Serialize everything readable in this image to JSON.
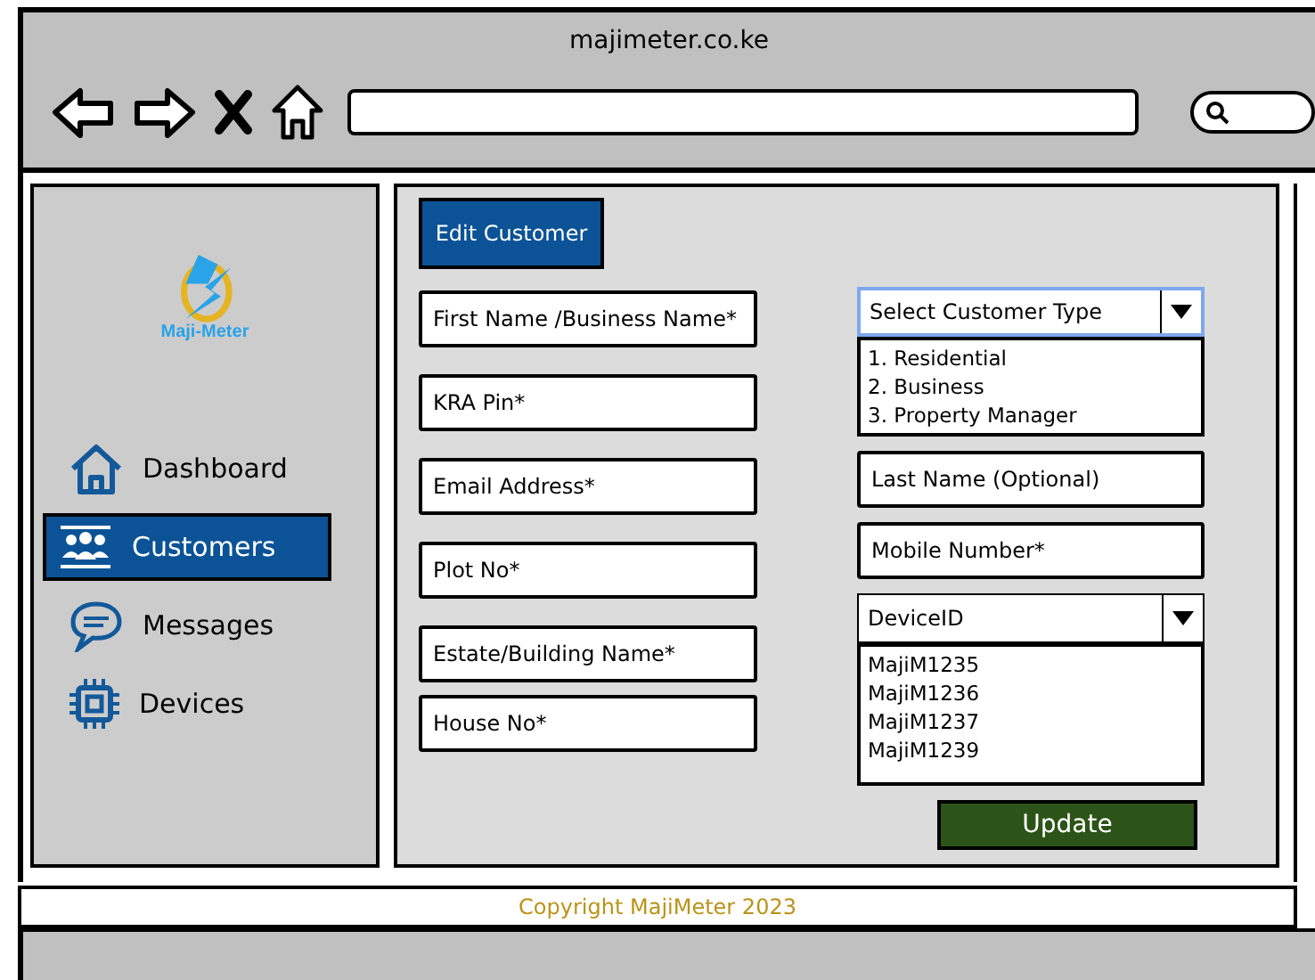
{
  "browser": {
    "title": "majimeter.co.ke"
  },
  "sidebar": {
    "logo_text": "Maji-Meter",
    "items": [
      {
        "label": "Dashboard",
        "kind": "home",
        "selected": false
      },
      {
        "label": "Customers",
        "kind": "people",
        "selected": true
      },
      {
        "label": "Messages",
        "kind": "sms",
        "selected": false
      },
      {
        "label": "Devices",
        "kind": "chip",
        "selected": false
      }
    ]
  },
  "form": {
    "heading": "Edit Customer",
    "left_fields": [
      {
        "placeholder": "First Name /Business Name*"
      },
      {
        "placeholder": "KRA Pin*"
      },
      {
        "placeholder": "Email Address*"
      },
      {
        "placeholder": "Plot No*"
      },
      {
        "placeholder": "Estate/Building Name*"
      },
      {
        "placeholder": "House No*"
      }
    ],
    "customer_type": {
      "value": "Select Customer Type",
      "focused": true,
      "options": [
        "1. Residential",
        "2. Business",
        "3. Property Manager"
      ]
    },
    "right_fields": [
      {
        "placeholder": "Last Name (Optional)"
      },
      {
        "placeholder": "Mobile Number*"
      }
    ],
    "device": {
      "value": "DeviceID",
      "focused": false,
      "options": [
        "MajiM1235",
        "MajiM1236",
        "MajiM1237",
        "MajiM1239"
      ]
    },
    "submit": "Update"
  },
  "footer": {
    "text": "Copyright MajiMeter 2023"
  }
}
